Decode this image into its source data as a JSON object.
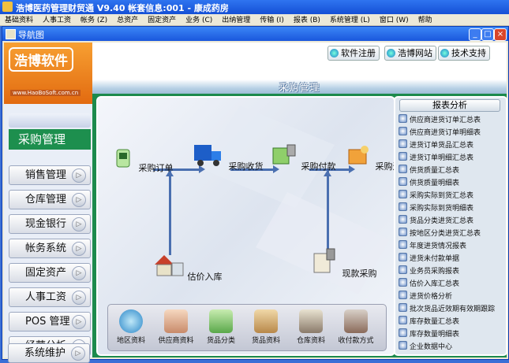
{
  "app_title": "浩博医药管理财贸通 V9.40    帐套信息:001 - 康成药房",
  "menu": [
    "基础资料",
    "人事工资",
    "帐务 (Z)",
    "总资产",
    "固定资产",
    "业务 (C)",
    "出纳管理",
    "传输 (I)",
    "报表 (B)",
    "系统管理 (L)",
    "窗口 (W)",
    "帮助"
  ],
  "inner_window_title": "导航图",
  "window_buttons": {
    "minimize": "_",
    "maximize": "□",
    "close": "×"
  },
  "logo": {
    "text": "浩博软件",
    "url": "www.HaoBoSoft.com.cn"
  },
  "top_buttons": [
    "软件注册",
    "浩博网站",
    "技术支持"
  ],
  "section_title": "采购管理",
  "current_module": "采购管理",
  "nav_items": [
    "销售管理",
    "仓库管理",
    "现金银行",
    "帐务系统",
    "固定资产",
    "人事工资",
    "POS 管理",
    "经营分析",
    "系统维护"
  ],
  "flow_nodes": [
    "采购订单",
    "采购收货",
    "采购付款",
    "采购退货",
    "估价入库",
    "现款采购"
  ],
  "tray_items": [
    "地区资料",
    "供应商资料",
    "货品分类",
    "货品资料",
    "仓库资料",
    "收付款方式"
  ],
  "report_title": "报表分析",
  "reports": [
    "供应商进货订单汇总表",
    "供应商进货订单明细表",
    "进货订单货品汇总表",
    "进货订单明细汇总表",
    "供货质量汇总表",
    "供货质量明细表",
    "采购实际到货汇总表",
    "采购实际到货明细表",
    "货品分类进货汇总表",
    "按地区分类进货汇总表",
    "年度进货情况报表",
    "进货未付款单据",
    "业务员采购报表",
    "估价入库汇总表",
    "进货价格分析",
    "批次货品近效期有效期跟踪",
    "库存数量汇总表",
    "库存数量明细表",
    "企业数据中心"
  ],
  "colors": {
    "title_blue": "#1550d6",
    "panel_green": "#1c8a4c",
    "logo_orange": "#e26a10"
  }
}
